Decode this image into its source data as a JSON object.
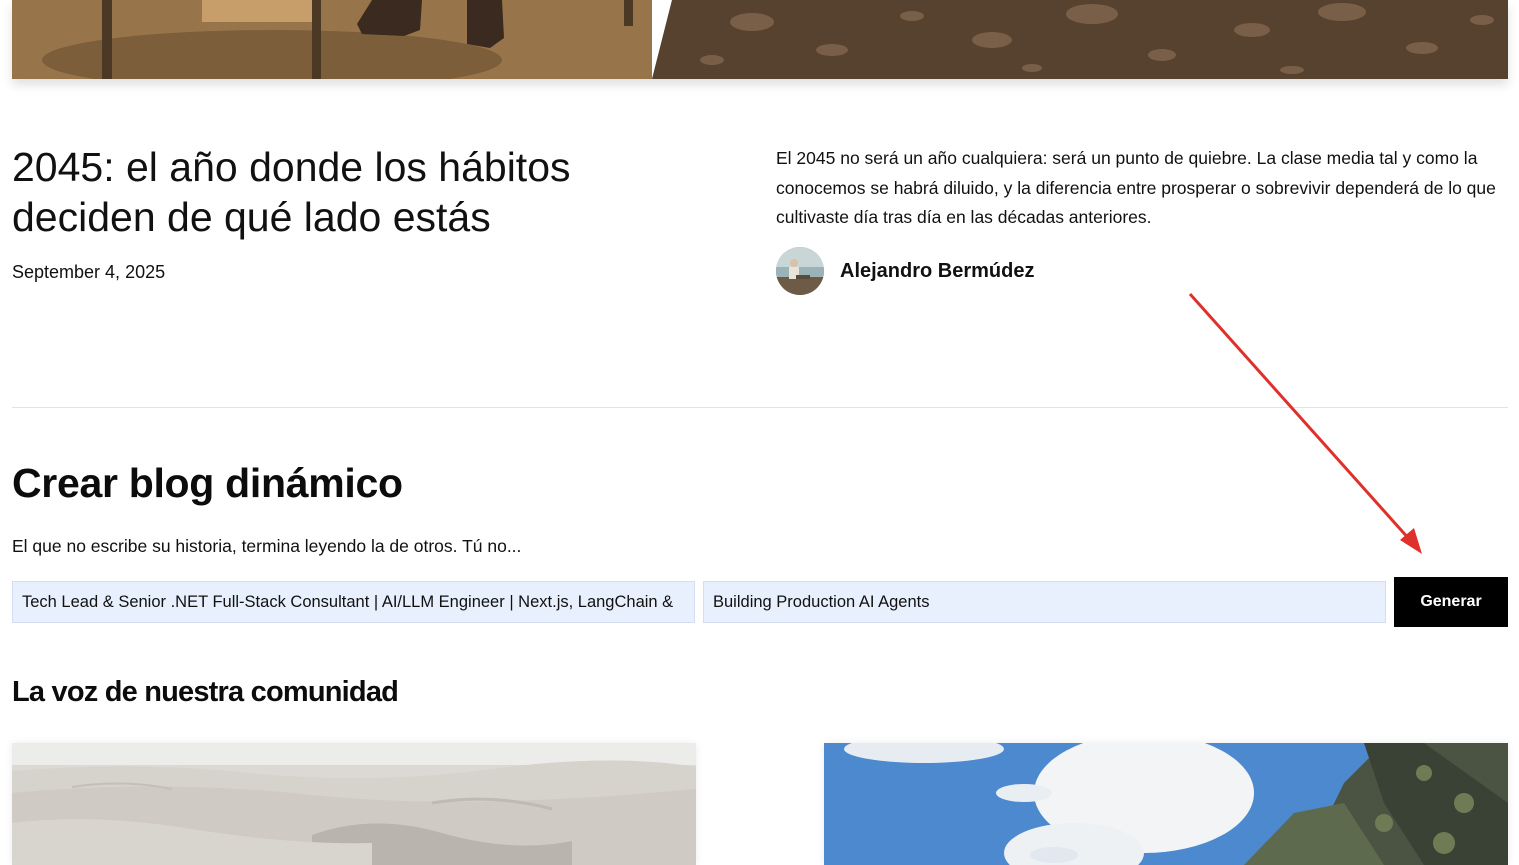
{
  "post": {
    "title": "2045: el año donde los hábitos deciden de qué lado estás",
    "date": "September 4, 2025",
    "excerpt": "El 2045 no será un año cualquiera: será un punto de quiebre. La clase media tal y como la conocemos se habrá diluido, y la diferencia entre prosperar o sobrevivir dependerá de lo que cultivaste día tras día en las décadas anteriores.",
    "author_name": "Alejandro Bermúdez"
  },
  "create_blog": {
    "title": "Crear blog dinámico",
    "subtitle": "El que no escribe su historia, termina leyendo la de otros. Tú no...",
    "input_profile_value": "Tech Lead & Senior .NET Full-Stack Consultant | AI/LLM Engineer | Next.js, LangChain &",
    "input_topic_value": "Building Production AI Agents",
    "generate_label": "Generar"
  },
  "community": {
    "title": "La voz de nuestra comunidad"
  },
  "colors": {
    "button_bg": "#000000",
    "input_bg": "#e8f0fe",
    "annotation_arrow": "#e0302c"
  }
}
